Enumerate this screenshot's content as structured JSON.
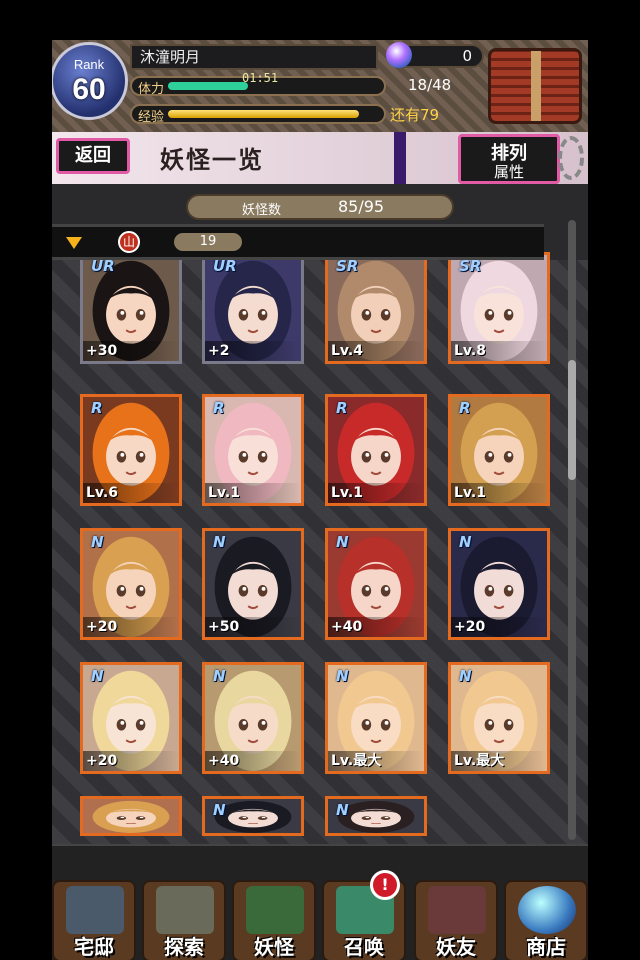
{
  "player": {
    "rank_label": "Rank",
    "rank": "60",
    "name": "沐潼明月",
    "gems": "0",
    "stamina_label": "体力",
    "stamina_timer": "01:51",
    "stamina_value": "18/48",
    "stamina_fill": 0.375,
    "exp_label": "经验",
    "exp_remaining": "还有79",
    "exp_fill": 0.9
  },
  "titlebar": {
    "back_label": "返回",
    "title": "妖怪一览",
    "sort_line1": "排列",
    "sort_line2": "属性"
  },
  "collection": {
    "count_label": "妖怪数",
    "count_value": "85/95"
  },
  "filter": {
    "icon_label": "山",
    "value": "19"
  },
  "cards": [
    {
      "rarity": "UR",
      "level": "+30",
      "bg": "#6d5a4a",
      "hair": "#1a1414",
      "skin": "#f6d6c0",
      "ur": true
    },
    {
      "rarity": "UR",
      "level": "+2",
      "bg": "#3d3a6a",
      "hair": "#25264a",
      "skin": "#f4dcd0",
      "ur": true
    },
    {
      "rarity": "SR",
      "level": "Lv.4",
      "bg": "#8a6a5a",
      "hair": "#b08a6a",
      "skin": "#f2cfb8",
      "ur": false
    },
    {
      "rarity": "SR",
      "level": "Lv.8",
      "bg": "#bfa8b0",
      "hair": "#f0d8e0",
      "skin": "#f8e2da",
      "ur": false
    },
    {
      "rarity": "R",
      "level": "Lv.6",
      "bg": "#7a3a20",
      "hair": "#e8721a",
      "skin": "#f6d8c4",
      "ur": false
    },
    {
      "rarity": "R",
      "level": "Lv.1",
      "bg": "#d8b8b0",
      "hair": "#f0b8c0",
      "skin": "#f8e0d8",
      "ur": false
    },
    {
      "rarity": "R",
      "level": "Lv.1",
      "bg": "#8a2a2a",
      "hair": "#c82a2a",
      "skin": "#f6d6c8",
      "ur": false
    },
    {
      "rarity": "R",
      "level": "Lv.1",
      "bg": "#b07a40",
      "hair": "#d2a050",
      "skin": "#f6d4bc",
      "ur": false
    },
    {
      "rarity": "N",
      "level": "+20",
      "bg": "#b0704a",
      "hair": "#d8a050",
      "skin": "#f6d4bc",
      "ur": false
    },
    {
      "rarity": "N",
      "level": "+50",
      "bg": "#3a3a44",
      "hair": "#1a1a22",
      "skin": "#f2dcd4",
      "ur": false
    },
    {
      "rarity": "N",
      "level": "+40",
      "bg": "#9a3a30",
      "hair": "#b8302a",
      "skin": "#f6d6c8",
      "ur": false
    },
    {
      "rarity": "N",
      "level": "+20",
      "bg": "#2a2a4a",
      "hair": "#1a1a30",
      "skin": "#f2dcd8",
      "ur": false
    },
    {
      "rarity": "N",
      "level": "+20",
      "bg": "#c8a890",
      "hair": "#f0d89a",
      "skin": "#f8e4d4",
      "ur": false
    },
    {
      "rarity": "N",
      "level": "+40",
      "bg": "#b89a70",
      "hair": "#e8d8a0",
      "skin": "#f6dcc8",
      "ur": false
    },
    {
      "rarity": "N",
      "level": "Lv.最大",
      "bg": "#e0b890",
      "hair": "#f0c890",
      "skin": "#f8dcc4",
      "ur": false
    },
    {
      "rarity": "N",
      "level": "Lv.最大",
      "bg": "#e0b890",
      "hair": "#f0c890",
      "skin": "#f8dcc4",
      "ur": false
    },
    {
      "rarity": "",
      "level": "",
      "bg": "#b07050",
      "hair": "#d8a050",
      "skin": "#f6d4bc",
      "ur": false
    },
    {
      "rarity": "N",
      "level": "",
      "bg": "#3a3a44",
      "hair": "#1a1a22",
      "skin": "#f2dcd4",
      "ur": false
    },
    {
      "rarity": "N",
      "level": "",
      "bg": "#3a3a44",
      "hair": "#2a2022",
      "skin": "#f2dcd4",
      "ur": false
    }
  ],
  "nav": [
    {
      "label": "宅邸",
      "icon": "house-icon",
      "color": "#4a5a6a"
    },
    {
      "label": "探索",
      "icon": "magnifier-icon",
      "color": "#6a6a5a"
    },
    {
      "label": "妖怪",
      "icon": "monster-icon",
      "color": "#3a6a3a"
    },
    {
      "label": "召唤",
      "icon": "summon-star-icon",
      "color": "#3a8a6a"
    },
    {
      "label": "妖友",
      "icon": "friend-icon",
      "color": "#6a3a3a"
    },
    {
      "label": "商店",
      "icon": "shop-orb-icon",
      "color": "#3a5a8a"
    }
  ],
  "summon_badge": "!"
}
